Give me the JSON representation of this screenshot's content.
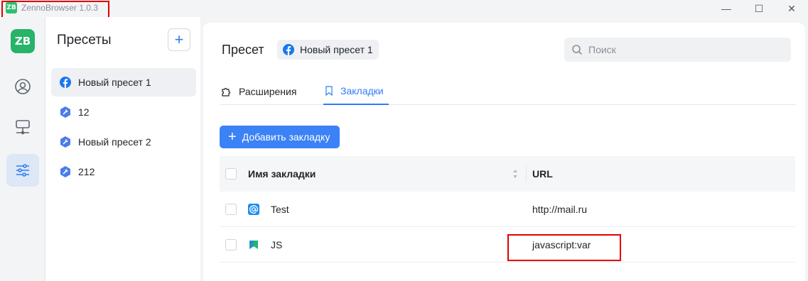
{
  "titlebar": {
    "logo_text": "ZB",
    "title": "ZennoBrowser 1.0.3",
    "minimize": "—",
    "maximize": "☐",
    "close": "✕"
  },
  "rail": {
    "logo_text": "ZB",
    "items": [
      {
        "icon": "profile-icon"
      },
      {
        "icon": "proxy-server-icon"
      },
      {
        "icon": "sliders-icon",
        "active": true
      }
    ]
  },
  "presets": {
    "title": "Пресеты",
    "add_label": "+",
    "items": [
      {
        "label": "Новый пресет 1",
        "icon": "facebook-icon",
        "active": true
      },
      {
        "label": "12",
        "icon": "wrench-icon"
      },
      {
        "label": "Новый пресет 2",
        "icon": "wrench-icon"
      },
      {
        "label": "212",
        "icon": "wrench-icon"
      }
    ]
  },
  "main": {
    "preset_label": "Пресет",
    "preset_chip": "Новый пресет 1",
    "search_placeholder": "Поиск",
    "tabs": [
      {
        "label": "Расширения",
        "icon": "puzzle-icon",
        "active": false
      },
      {
        "label": "Закладки",
        "icon": "bookmark-icon",
        "active": true
      }
    ],
    "add_bookmark_label": "Добавить закладку",
    "table": {
      "col_name": "Имя закладки",
      "col_url": "URL",
      "rows": [
        {
          "name": "Test",
          "url": "http://mail.ru",
          "icon": "at-sign-icon"
        },
        {
          "name": "JS",
          "url": "javascript:var",
          "icon": "bookmark-flag-icon"
        }
      ]
    }
  },
  "colors": {
    "accent": "#2f7cf6",
    "brand": "#27b36a",
    "highlight": "#e00000"
  }
}
